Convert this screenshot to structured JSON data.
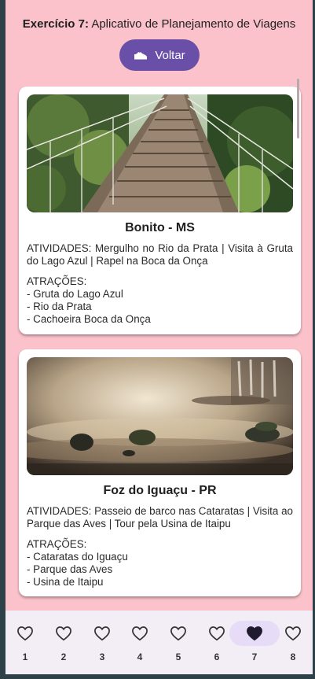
{
  "header": {
    "exercise": "Exercício 7:",
    "title": "Aplicativo de Planejamento de Viagens"
  },
  "back_button": {
    "label": "Voltar",
    "icon": "sneaker-icon"
  },
  "destinations": [
    {
      "title": "Bonito - MS",
      "activities": "ATIVIDADES: Mergulho no Rio da Prata | Visita à Gruta do Lago Azul | Rapel na Boca da Onça",
      "attractions_label": "ATRAÇÕES:",
      "attractions": [
        "- Gruta do Lago Azul",
        "- Rio da Prata",
        "- Cachoeira Boca da Onça"
      ]
    },
    {
      "title": "Foz do Iguaçu - PR",
      "activities": "ATIVIDADES: Passeio de barco nas Cataratas | Visita ao Parque das Aves | Tour pela Usina de Itaipu",
      "attractions_label": "ATRAÇÕES:",
      "attractions": [
        "- Cataratas do Iguaçu",
        "- Parque das Aves",
        "- Usina de Itaipu"
      ]
    }
  ],
  "tabs": [
    {
      "label": "1",
      "icon": "heart-outline-icon"
    },
    {
      "label": "2",
      "icon": "heart-outline-icon"
    },
    {
      "label": "3",
      "icon": "heart-outline-icon"
    },
    {
      "label": "4",
      "icon": "heart-outline-icon"
    },
    {
      "label": "5",
      "icon": "heart-outline-icon"
    },
    {
      "label": "6",
      "icon": "heart-outline-icon"
    },
    {
      "label": "7",
      "icon": "heart-filled-icon",
      "active": true
    },
    {
      "label": "8",
      "icon": "heart-outline-icon"
    }
  ],
  "colors": {
    "background": "#fbc2cb",
    "accent": "#6a4fa8",
    "tabbar": "#f3eef5",
    "active_pill": "#e6dcf7"
  }
}
